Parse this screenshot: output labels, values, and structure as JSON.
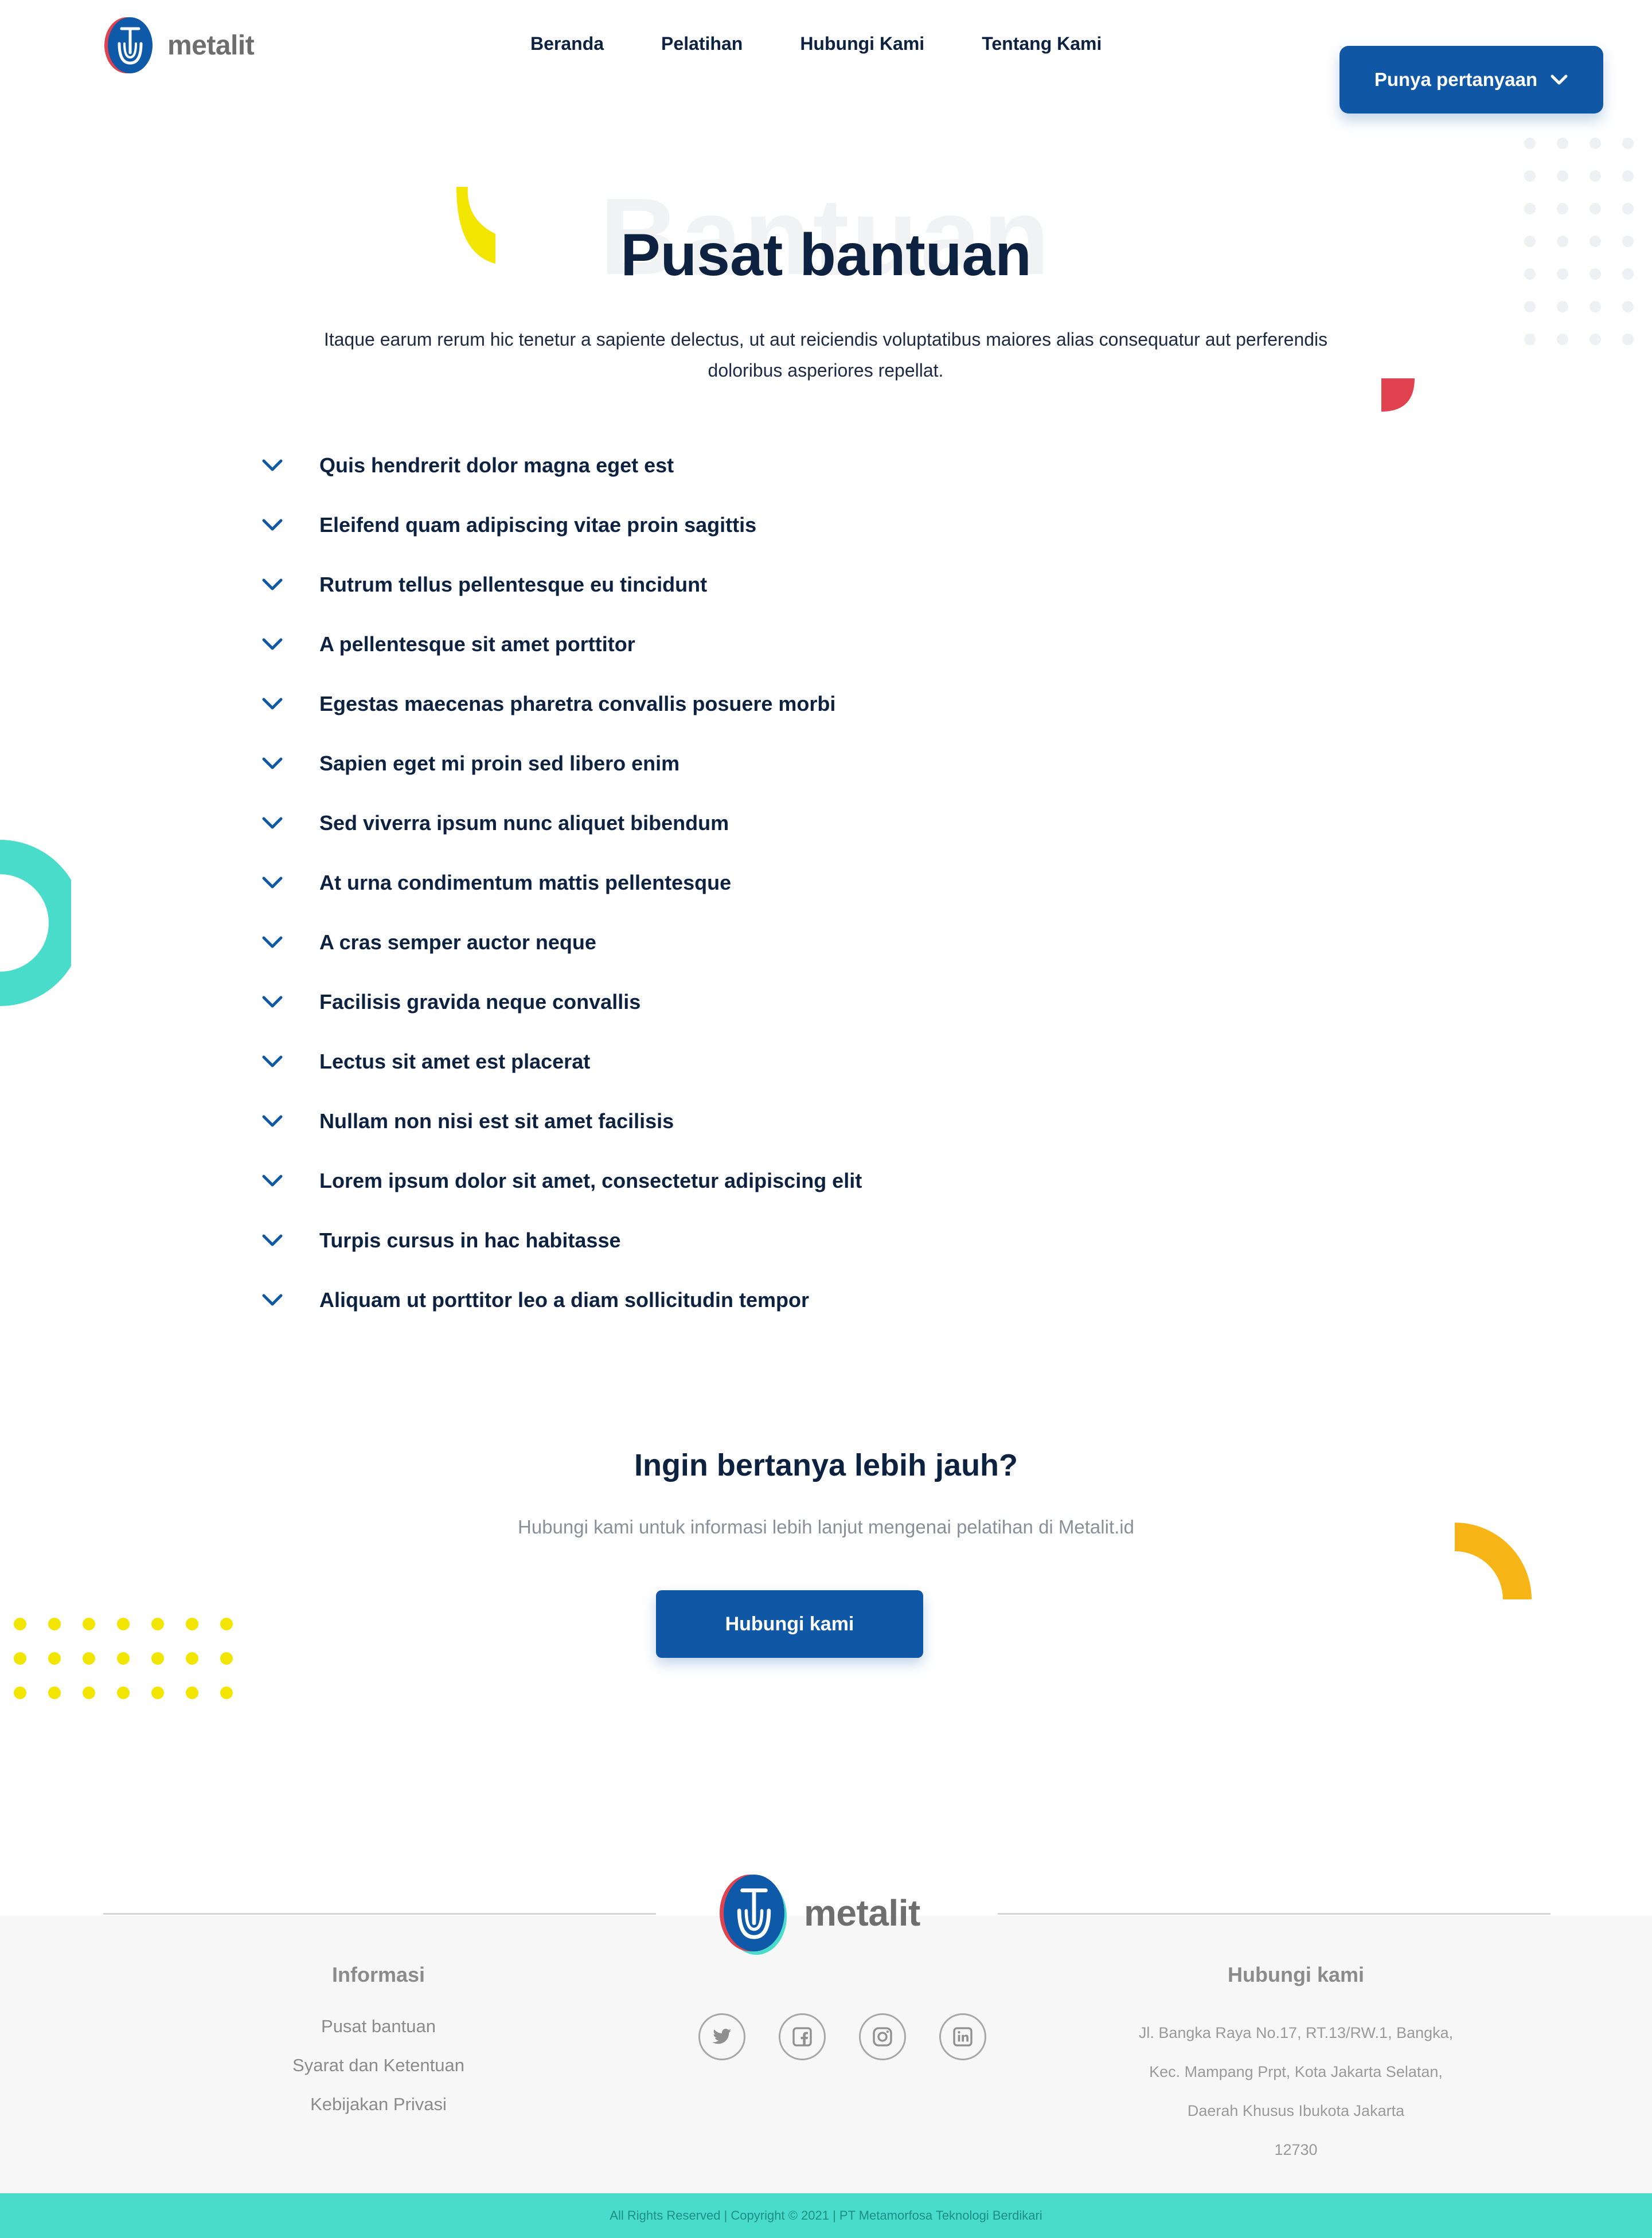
{
  "header": {
    "logo_text": "metalit",
    "nav": [
      "Beranda",
      "Pelatihan",
      "Hubungi Kami",
      "Tentang Kami"
    ],
    "question_button": "Punya pertanyaan"
  },
  "hero": {
    "watermark": "Bantuan",
    "title": "Pusat bantuan",
    "description": "Itaque earum rerum hic tenetur a sapiente delectus, ut aut reiciendis voluptatibus maiores alias consequatur aut perferendis doloribus asperiores repellat."
  },
  "faq": [
    "Quis hendrerit dolor magna eget est",
    "Eleifend quam adipiscing vitae proin sagittis",
    "Rutrum tellus pellentesque eu tincidunt",
    "A pellentesque sit amet porttitor",
    "Egestas maecenas pharetra convallis posuere morbi",
    "Sapien eget mi proin sed libero enim",
    "Sed viverra ipsum nunc aliquet bibendum",
    "At urna condimentum mattis pellentesque",
    "A cras semper auctor neque",
    "Facilisis gravida neque convallis",
    "Lectus sit amet est placerat",
    "Nullam non nisi est sit amet facilisis",
    "Lorem ipsum dolor sit amet, consectetur adipiscing elit",
    "Turpis cursus in hac habitasse",
    "Aliquam ut porttitor leo a diam sollicitudin tempor"
  ],
  "cta": {
    "title": "Ingin bertanya lebih jauh?",
    "subtitle": "Hubungi kami untuk informasi lebih lanjut mengenai pelatihan di Metalit.id",
    "button": "Hubungi kami"
  },
  "footer": {
    "logo_text": "metalit",
    "info_title": "Informasi",
    "info_links": [
      "Pusat bantuan",
      "Syarat dan Ketentuan",
      "Kebijakan Privasi"
    ],
    "social_icons": [
      "twitter-icon",
      "facebook-icon",
      "instagram-icon",
      "linkedin-icon"
    ],
    "contact_title": "Hubungi kami",
    "address_lines": [
      "Jl. Bangka Raya No.17, RT.13/RW.1, Bangka,",
      "Kec. Mampang Prpt, Kota Jakarta Selatan,",
      "Daerah Khusus Ibukota Jakarta",
      "12730"
    ],
    "copyright": "All Rights Reserved | Copyright © 2021 | PT Metamorfosa Teknologi Berdikari"
  },
  "colors": {
    "primary": "#1058a6",
    "navy_text": "#0d2240",
    "teal": "#49dcca",
    "yellow": "#f2e500",
    "orange": "#f8b517",
    "red": "#e0424f"
  }
}
